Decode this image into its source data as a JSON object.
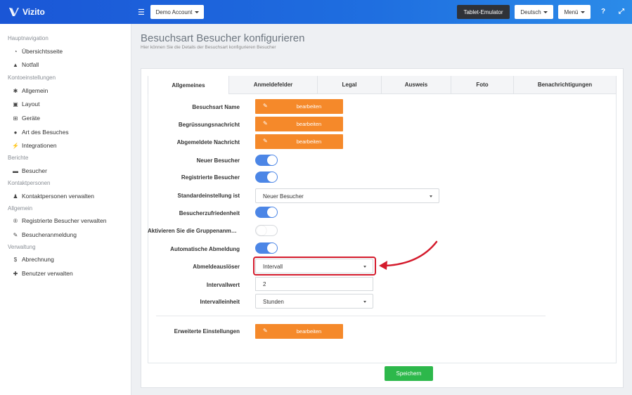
{
  "brand": {
    "name": "Vizito"
  },
  "topbar": {
    "account": "Demo Account",
    "tablet_emulator": "Tablet-Emulator",
    "language": "Deutsch",
    "menu": "Menü"
  },
  "sidebar": {
    "sections": [
      {
        "title": "Hauptnavigation",
        "items": [
          {
            "label": "Übersichtsseite",
            "icon": "dashboard-icon"
          },
          {
            "label": "Notfall",
            "icon": "warning-icon"
          }
        ]
      },
      {
        "title": "Kontoeinstellungen",
        "items": [
          {
            "label": "Allgemein",
            "icon": "gear-icon"
          },
          {
            "label": "Layout",
            "icon": "image-icon"
          },
          {
            "label": "Geräte",
            "icon": "sitemap-icon"
          },
          {
            "label": "Art des Besuches",
            "icon": "users-icon"
          },
          {
            "label": "Integrationen",
            "icon": "plug-icon"
          }
        ]
      },
      {
        "title": "Berichte",
        "items": [
          {
            "label": "Besucher",
            "icon": "book-icon"
          }
        ]
      },
      {
        "title": "Kontaktpersonen",
        "items": [
          {
            "label": "Kontaktpersonen verwalten",
            "icon": "person-icon"
          }
        ]
      },
      {
        "title": "Allgemein",
        "items": [
          {
            "label": "Registrierte Besucher verwalten",
            "icon": "registered-icon"
          },
          {
            "label": "Besucheranmeldung",
            "icon": "pencil-icon"
          }
        ]
      },
      {
        "title": "Verwaltung",
        "items": [
          {
            "label": "Abrechnung",
            "icon": "dollar-icon"
          },
          {
            "label": "Benutzer verwalten",
            "icon": "user-plus-icon"
          }
        ]
      }
    ]
  },
  "page": {
    "title": "Besuchsart Besucher konfigurieren",
    "subtitle": "Hier können Sie die Details der Besuchsart konfigurieren Besucher"
  },
  "tabs": [
    "Allgemeines",
    "Anmeldefelder",
    "Legal",
    "Ausweis",
    "Foto",
    "Benachrichtigungen"
  ],
  "form": {
    "edit_label": "bearbeiten",
    "fields": {
      "name": "Besuchsart Name",
      "greeting": "Begrüssungsnachricht",
      "logout_msg": "Abgemeldete Nachricht",
      "new_visitor": "Neuer Besucher",
      "registered_visitor": "Registrierte Besucher",
      "default_setting": "Standardeinstellung ist",
      "satisfaction": "Besucherzufriedenheit",
      "group_reg": "Aktivieren Sie die Gruppenanmeldung",
      "auto_logout": "Automatische Abmeldung",
      "logout_trigger": "Abmeldeauslöser",
      "interval_value": "Intervallwert",
      "interval_unit": "Intervalleinheit",
      "advanced": "Erweiterte Einstellungen"
    },
    "values": {
      "default_setting": "Neuer Besucher",
      "logout_trigger": "Intervall",
      "interval_value": "2",
      "interval_unit": "Stunden"
    },
    "toggles": {
      "new_visitor": true,
      "registered_visitor": true,
      "satisfaction": true,
      "group_reg": false,
      "auto_logout": true
    }
  },
  "save_label": "Speichern",
  "colors": {
    "primary": "#1f6fe0",
    "orange": "#f5892a",
    "green": "#2db84b",
    "highlight": "#d41b2c",
    "toggle_on": "#4c86e6"
  }
}
